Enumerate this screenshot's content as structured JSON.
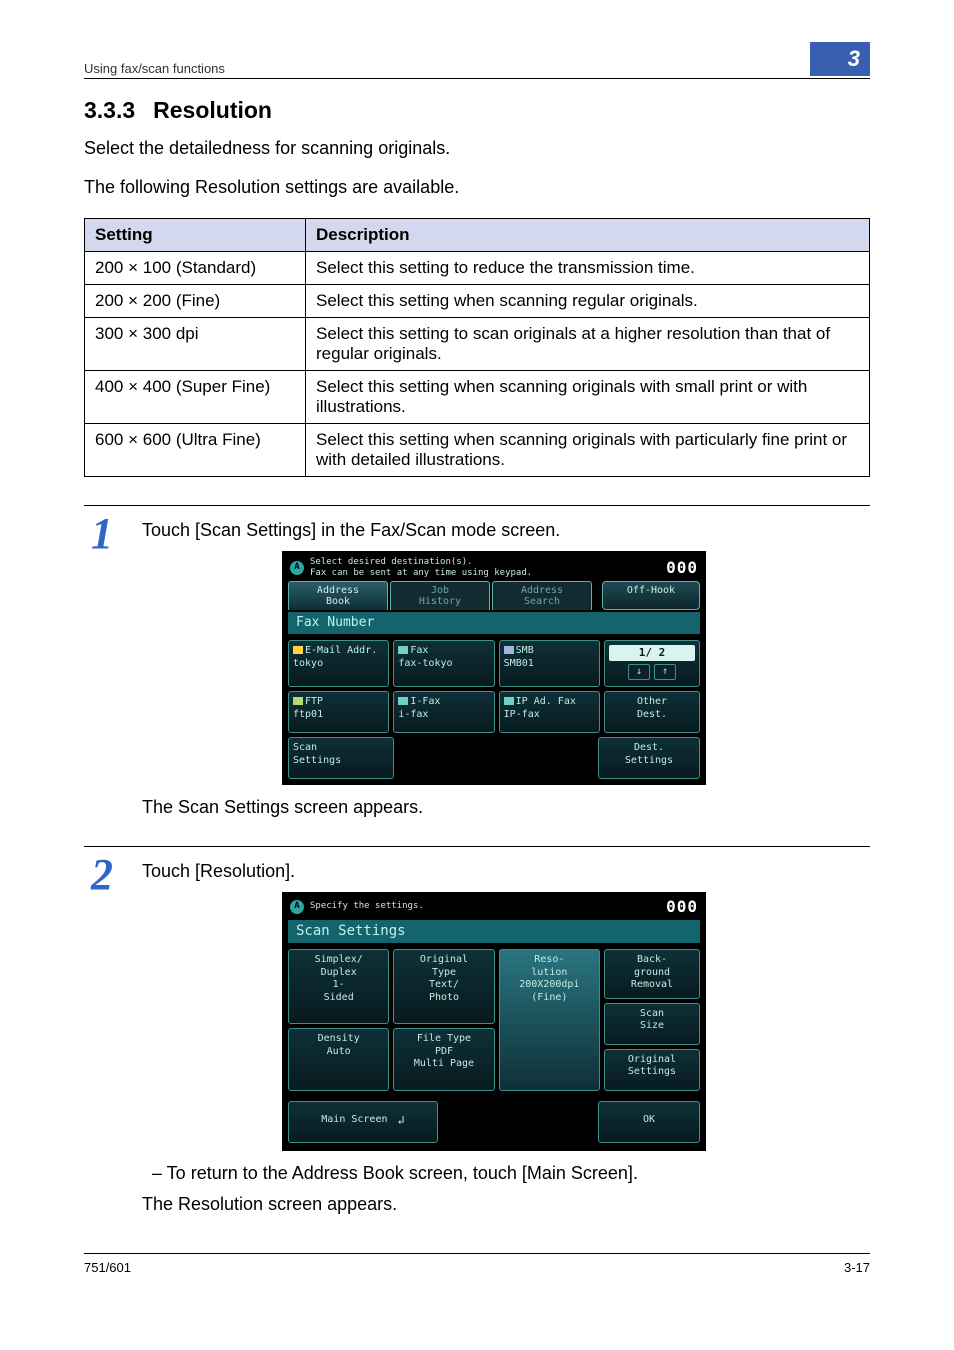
{
  "header": {
    "running": "Using fax/scan functions",
    "chapter_number": "3"
  },
  "section": {
    "number": "3.3.3",
    "title": "Resolution"
  },
  "intro": {
    "p1": "Select the detailedness for scanning originals.",
    "p2": "The following Resolution settings are available."
  },
  "table": {
    "head": {
      "setting": "Setting",
      "description": "Description"
    },
    "rows": [
      {
        "setting": "200 × 100 (Standard)",
        "description": "Select this setting to reduce the transmission time."
      },
      {
        "setting": "200 × 200 (Fine)",
        "description": "Select this setting when scanning regular originals."
      },
      {
        "setting": "300 × 300 dpi",
        "description": "Select this setting to scan originals at a higher resolution than that of regular originals."
      },
      {
        "setting": "400 × 400 (Super Fine)",
        "description": "Select this setting when scanning originals with small print or with illustrations."
      },
      {
        "setting": "600 × 600 (Ultra Fine)",
        "description": "Select this setting when scanning originals with particularly fine print or with detailed illustrations."
      }
    ]
  },
  "step1": {
    "num": "1",
    "text": "Touch [Scan Settings] in the Fax/Scan mode screen.",
    "after": "The Scan Settings screen appears.",
    "lcd": {
      "prompt1": "Select desired destination(s).",
      "prompt2": "Fax can be sent at any time using keypad.",
      "counter": "000",
      "tabs": {
        "t1": "Address\nBook",
        "t2": "Job\nHistory",
        "t3": "Address\nSearch",
        "side": "Off-Hook"
      },
      "bar": "Fax Number",
      "cells": {
        "c11a": "E-Mail Addr.",
        "c11b": "tokyo",
        "c12a": "Fax",
        "c12b": "fax-tokyo",
        "c13a": "SMB",
        "c13b": "SMB01",
        "page": "1/  2",
        "c21a": "FTP",
        "c21b": "ftp01",
        "c22a": "I-Fax",
        "c22b": "i-fax",
        "c23a": "IP Ad. Fax",
        "c23b": "IP-fax",
        "other": "Other\nDest."
      },
      "bottom": {
        "left": "Scan\nSettings",
        "right": "Dest.\nSettings"
      }
    }
  },
  "step2": {
    "num": "2",
    "text": "Touch [Resolution].",
    "bullet": "– To return to the Address Book screen, touch [Main Screen].",
    "after": "The Resolution screen appears.",
    "lcd": {
      "prompt1": "Specify the settings.",
      "counter": "000",
      "title": "Scan Settings",
      "cells": {
        "c11a": "Simplex/\nDuplex",
        "c11b": "1-\nSided",
        "c12a": "Original\nType",
        "c12b": "Text/\nPhoto",
        "c13a": "Reso-\nlution",
        "c13b": "200X200dpi\n(Fine)",
        "rs1": "Back-\nground\nRemoval",
        "rs2": "Scan\nSize",
        "c21a": "Density",
        "c21b": "Auto",
        "c22a": "File Type",
        "c22b": "PDF\nMulti Page",
        "rs3": "Original\nSettings"
      },
      "foot": {
        "main": "Main Screen",
        "ok": "OK"
      }
    }
  },
  "footer": {
    "left": "751/601",
    "right": "3-17"
  }
}
